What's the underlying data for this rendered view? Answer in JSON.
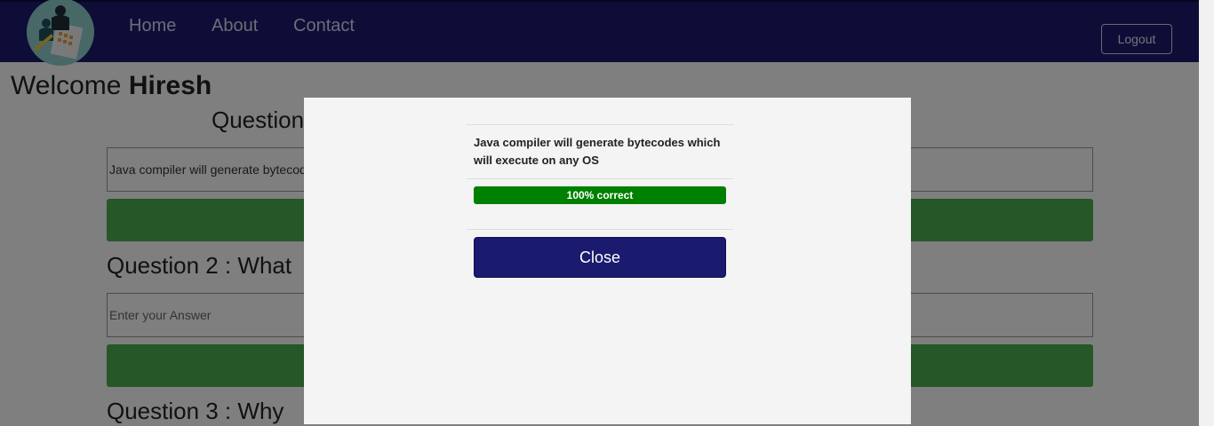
{
  "nav": {
    "home": "Home",
    "about": "About",
    "contact": "Contact",
    "logout": "Logout"
  },
  "welcome": {
    "prefix": "Welcome ",
    "name": "Hiresh"
  },
  "questions": [
    {
      "title": "Question",
      "answer_value": "Java compiler will generate bytecod"
    },
    {
      "title": "Question 2 : What",
      "answer_placeholder": "Enter your Answer"
    },
    {
      "title": "Question 3 : Why"
    }
  ],
  "modal": {
    "question_text": "Java compiler will generate bytecodes which will execute on any OS",
    "progress": {
      "label": "100% correct",
      "percent": 100,
      "color": "#008000"
    },
    "close_label": "Close"
  },
  "colors": {
    "navbar": "#1a1a6e",
    "submit_button": "#4caf50",
    "close_button": "#1a1a6e"
  }
}
